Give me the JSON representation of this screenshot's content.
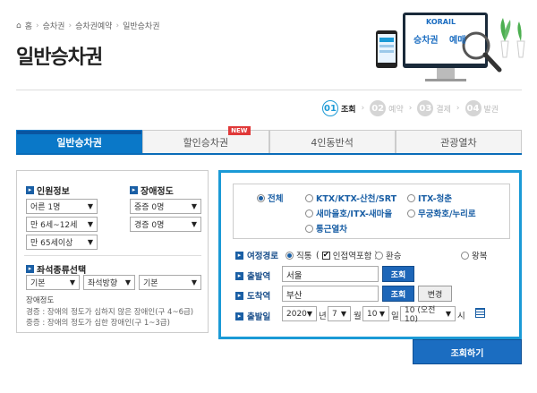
{
  "breadcrumb": {
    "home": "홈",
    "items": [
      "승차권",
      "승차권예약",
      "일반승차권"
    ]
  },
  "page_title": "일반승차권",
  "hero": {
    "brand": "KORAIL",
    "text_a": "승차권",
    "text_b": "예매"
  },
  "steps": [
    {
      "num": "01",
      "label": "조회"
    },
    {
      "num": "02",
      "label": "예약"
    },
    {
      "num": "03",
      "label": "결제"
    },
    {
      "num": "04",
      "label": "발권"
    }
  ],
  "tabs": [
    "일반승차권",
    "할인승차권",
    "4인동반석",
    "관광열차"
  ],
  "new_badge": "NEW",
  "left": {
    "passenger_title": "인원정보",
    "adult": "어른 1명",
    "child": "만 6세~12세",
    "senior": "만 65세이상",
    "disability_title": "장애정도",
    "severe": "중증 0명",
    "mild": "경증 0명",
    "seat_title": "좌석종류선택",
    "seat_a": "기본",
    "seat_b": "좌석방향",
    "seat_c": "기본",
    "note_title": "장애정도",
    "note_1": "경증 : 장애의 정도가 심하지 않은 장애인(구 4~6급)",
    "note_2": "중증 : 장애의 정도가 심한 장애인(구 1~3급)"
  },
  "train_classes": [
    "전체",
    "KTX/KTX-산천/SRT",
    "ITX-청춘",
    "새마을호/ITX-새마을",
    "무궁화호/누리로",
    "통근열차"
  ],
  "route": {
    "label": "여정경로",
    "direct": "직통",
    "transfer_check": "인접역포함",
    "transfer": "환승",
    "roundtrip": "왕복"
  },
  "departure": {
    "label": "출발역",
    "value": "서울",
    "button": "조회"
  },
  "arrival": {
    "label": "도착역",
    "value": "부산",
    "button": "조회",
    "swap": "변경"
  },
  "date": {
    "label": "출발일",
    "year": "2020",
    "year_unit": "년",
    "month": "7",
    "month_unit": "월",
    "day": "10",
    "day_unit": "일",
    "hour": "10 (오전10)",
    "hour_unit": "시"
  },
  "submit": "조회하기",
  "colors": {
    "accent": "#1b9ad6",
    "tab_active": "#0a78c8",
    "button": "#1b6dc1",
    "new": "#e03838"
  }
}
